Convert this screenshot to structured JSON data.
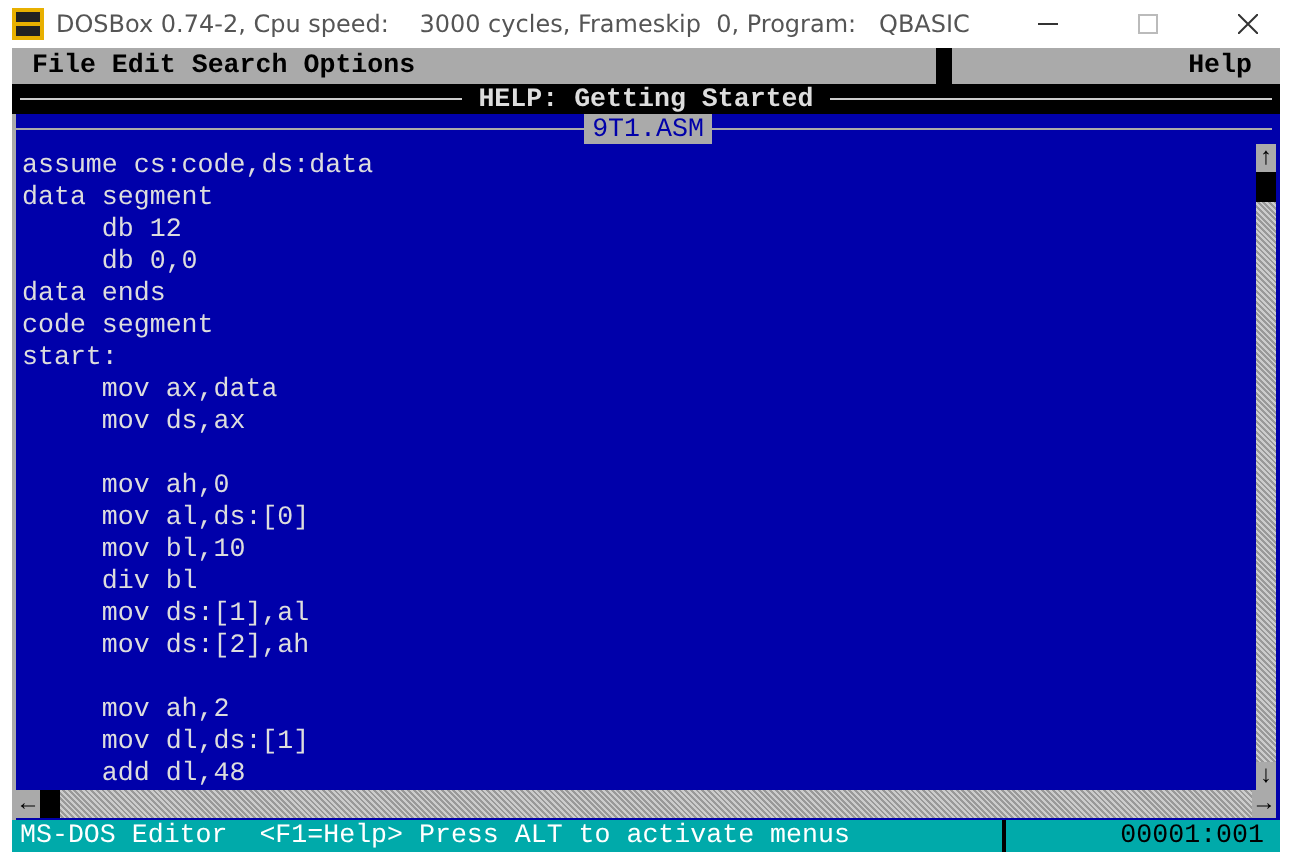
{
  "window": {
    "title": "DOSBox 0.74-2, Cpu speed:    3000 cycles, Frameskip  0, Program:   QBASIC"
  },
  "menu": [
    {
      "label": "File"
    },
    {
      "label": "Edit"
    },
    {
      "label": "Search"
    },
    {
      "label": "Options"
    }
  ],
  "help_menu": "Help",
  "help_title": "HELP: Getting Started",
  "file_name": "9T1.ASM",
  "code_blocks": [
    [
      "assume cs:code,ds:data",
      "data segment",
      "     db 12",
      "     db 0,0",
      "data ends",
      "code segment",
      "start:",
      "     mov ax,data",
      "     mov ds,ax"
    ],
    [
      "     mov ah,0",
      "     mov al,ds:[0]",
      "     mov bl,10",
      "     div bl",
      "     mov ds:[1],al",
      "     mov ds:[2],ah"
    ],
    [
      "     mov ah,2",
      "     mov dl,ds:[1]",
      "     add dl,48"
    ]
  ],
  "scroll_arrows": {
    "up": "↑",
    "down": "↓",
    "left": "←",
    "right": "→"
  },
  "status_bar": {
    "text": "MS-DOS Editor  <F1=Help> Press ALT to activate menus",
    "position": "00001:001"
  }
}
